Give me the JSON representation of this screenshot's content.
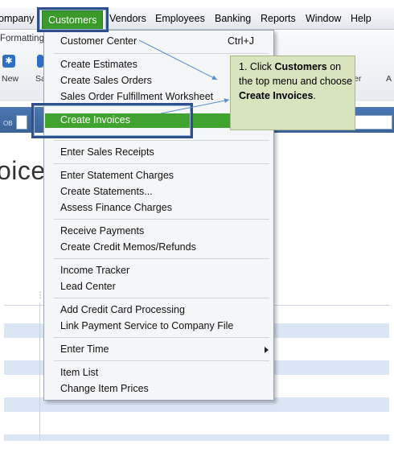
{
  "menubar": {
    "items": [
      "ompany",
      "Customers",
      "Vendors",
      "Employees",
      "Banking",
      "Reports",
      "Window",
      "Help"
    ],
    "active": "Customers"
  },
  "toolbar": {
    "tab": "Formatting",
    "new_label": "New",
    "sa_label": "Sa",
    "right_label_1": "er",
    "right_label_2": "A"
  },
  "bluebar": {
    "label": "OB"
  },
  "form": {
    "title": "oice"
  },
  "dropdown": {
    "customer_center": "Customer Center",
    "customer_center_shortcut": "Ctrl+J",
    "create_estimates": "Create Estimates",
    "create_sales_orders": "Create Sales Orders",
    "sales_order_fulfillment": "Sales Order Fulfillment Worksheet",
    "create_invoices": "Create Invoices",
    "enter_sales_receipts": "Enter Sales Receipts",
    "enter_statement_charges": "Enter Statement Charges",
    "create_statements": "Create Statements...",
    "assess_finance_charges": "Assess Finance Charges",
    "receive_payments": "Receive Payments",
    "create_credit_memos": "Create Credit Memos/Refunds",
    "income_tracker": "Income Tracker",
    "lead_center": "Lead Center",
    "add_credit_card": "Add Credit Card Processing",
    "link_payment": "Link Payment Service to Company File",
    "enter_time": "Enter Time",
    "item_list": "Item List",
    "change_item_prices": "Change Item Prices"
  },
  "callout": {
    "prefix": "1. Click ",
    "customers": "Customers",
    "middle": " on the top menu and choose ",
    "create_invoices": "Create Invoices",
    "suffix": "."
  },
  "colors": {
    "highlight_green": "#40a32f",
    "annotation_blue": "#2d4f8a",
    "callout_fill": "#d7e4bd",
    "toolbar_blue": "#3b6398"
  },
  "icons": [
    "new-icon",
    "save-icon",
    "submenu-arrow-icon",
    "grip-icon"
  ]
}
